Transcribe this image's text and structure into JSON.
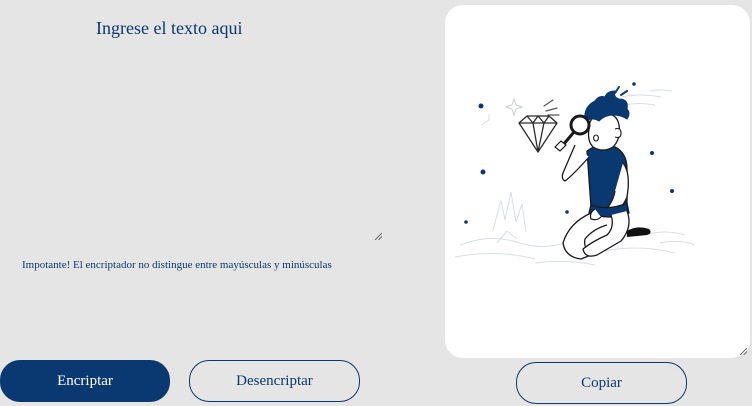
{
  "input": {
    "placeholder": "Ingrese el texto aqui"
  },
  "warning": {
    "text": "Impotante! El encriptador no distingue entre mayúsculas y minúsculas"
  },
  "buttons": {
    "encrypt_label": "Encriptar",
    "decrypt_label": "Desencriptar",
    "copy_label": "Copiar"
  },
  "output": {
    "illustration_icon": "person-with-magnifying-glass-illustration",
    "value": ""
  },
  "colors": {
    "background": "#e5e5e5",
    "accent": "#0a3871",
    "panel": "#ffffff"
  }
}
